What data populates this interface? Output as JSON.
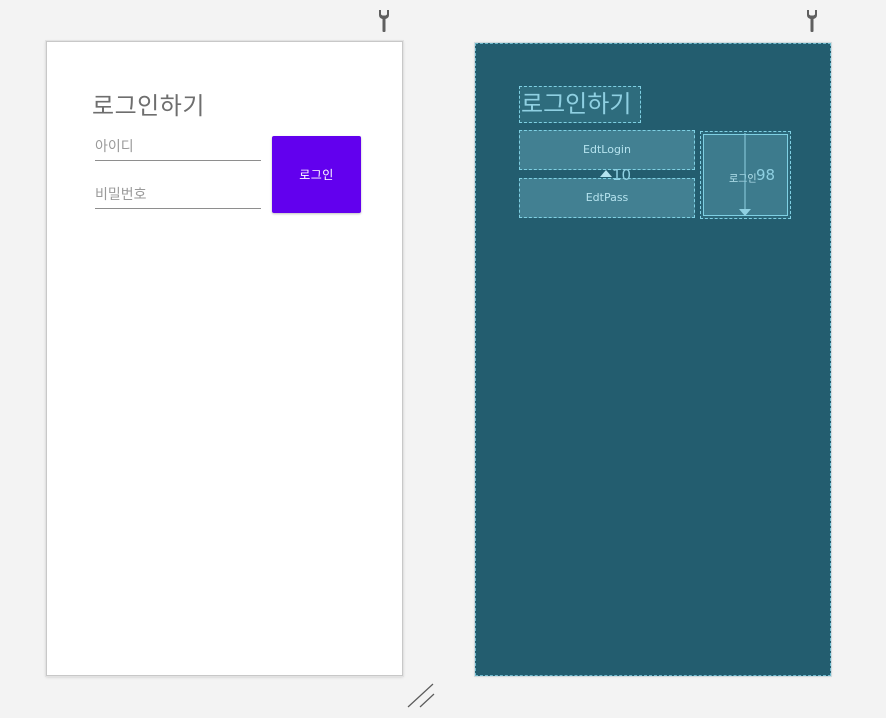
{
  "design": {
    "title": "로그인하기",
    "id_placeholder": "아이디",
    "pw_placeholder": "비밀번호",
    "login_button": "로그인"
  },
  "blueprint": {
    "title": "로그인하기",
    "edt_login": "EdtLogin",
    "edt_pass": "EdtPass",
    "button_label": "로그인",
    "margin_top": "10",
    "margin_right": "98"
  },
  "icons": {
    "wrench": "wrench-icon",
    "resize": "resize-handle-icon"
  },
  "colors": {
    "background": "#f3f3f3",
    "primary_button": "#6200ee",
    "blueprint_bg": "#235d6f",
    "blueprint_line": "#7fd0e3"
  }
}
